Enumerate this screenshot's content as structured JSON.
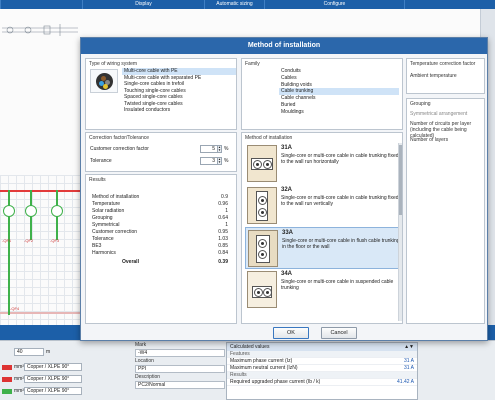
{
  "app": {
    "toolbar": [
      "",
      "Display",
      "Automatic sizing",
      "Configure",
      ""
    ],
    "bottom_left": [
      {
        "value": "40",
        "unit": "m"
      },
      {
        "value": "Copper / XLPE 90°",
        "unit": "mm²"
      },
      {
        "value": "Copper / XLPE 90°",
        "unit": "mm²"
      },
      {
        "value": "Copper / XLPE 90°",
        "unit": "mm²"
      }
    ],
    "properties": [
      {
        "label": "Mark",
        "value": "-W4"
      },
      {
        "label": "Location",
        "value": "PPI"
      },
      {
        "label": "Description",
        "value": "PC2/Normal"
      }
    ],
    "calc": {
      "title": "Calculated values",
      "rows": [
        {
          "type": "section",
          "label": "Features"
        },
        {
          "type": "row",
          "label": "Maximum phase current (Iz)",
          "value": "31 A"
        },
        {
          "type": "row",
          "label": "Maximum neutral current (IzN)",
          "value": "31 A"
        },
        {
          "type": "section",
          "label": "Results"
        },
        {
          "type": "row",
          "label": "Required upgraded phase current (Ib / k)",
          "value": "41.42 A"
        }
      ]
    },
    "schematic_labels": [
      "-QF1",
      "-QF2",
      "-QF3",
      "-QF4"
    ]
  },
  "dialog": {
    "title": "Method of installation",
    "wiring": {
      "title": "Type of wiring system",
      "selected_index": 0,
      "items": [
        "Multi-core cable with PE",
        "Multi-core cable with separated PE",
        "Single-core cables in trefoil",
        "Touching single-core cables",
        "Spaced single-core cables",
        "Twisted single-core cables",
        "Insulated conductors"
      ]
    },
    "correction": {
      "title": "Correction factor/Tolerance",
      "fields": [
        {
          "label": "Customer correction factor",
          "value": "5",
          "unit": "%"
        },
        {
          "label": "Tolerance",
          "value": "3",
          "unit": "%"
        }
      ]
    },
    "results": {
      "title": "Results",
      "rows": [
        {
          "label": "Method of installation",
          "value": "0.9"
        },
        {
          "label": "Temperature",
          "value": "0.96"
        },
        {
          "label": "Solar radiation",
          "value": "1"
        },
        {
          "label": "Grouping",
          "value": "0.64"
        },
        {
          "label": "Symmetrical",
          "value": "1"
        },
        {
          "label": "Customer correction",
          "value": "0.95"
        },
        {
          "label": "Tolerance",
          "value": "1.03"
        },
        {
          "label": "BE3",
          "value": "0.85"
        },
        {
          "label": "Harmonics",
          "value": "0.84"
        }
      ],
      "overall_label": "Overall",
      "overall_value": "0.39"
    },
    "family": {
      "title": "Family",
      "selected_index": 4,
      "items": [
        "Conduits",
        "Cables",
        "Building voids",
        "Cable trunking",
        "Cable channels",
        "Buried",
        "Mouldings"
      ]
    },
    "method": {
      "title": "Method of installation",
      "selected_index": 2,
      "items": [
        {
          "code": "31A",
          "desc": "Single-core or multi-core cable in cable trunking fixed to the wall run horizontally"
        },
        {
          "code": "32A",
          "desc": "Single-core or multi-core cable in cable trunking fixed to the wall run vertically"
        },
        {
          "code": "33A",
          "desc": "Single-core or multi-core cable in flush cable trunking in the floor or the wall"
        },
        {
          "code": "34A",
          "desc": "Single-core or multi-core cable in suspended cable trunking"
        }
      ]
    },
    "temperature": {
      "title": "Temperature correction factor",
      "ambient_label": "Ambient temperature"
    },
    "grouping": {
      "title": "Grouping",
      "symmetrical": "Symmetrical arrangement",
      "circuits_label": "Number of circuits per layer",
      "circuits_note": "(including the cable being calculated)",
      "layers_label": "Number of layers"
    },
    "buttons": {
      "ok": "OK",
      "cancel": "Cancel"
    },
    "colors": {
      "titlebar": "#2b67ab",
      "selection": "#cfe3f7",
      "accent": "#1c5fa8"
    }
  }
}
